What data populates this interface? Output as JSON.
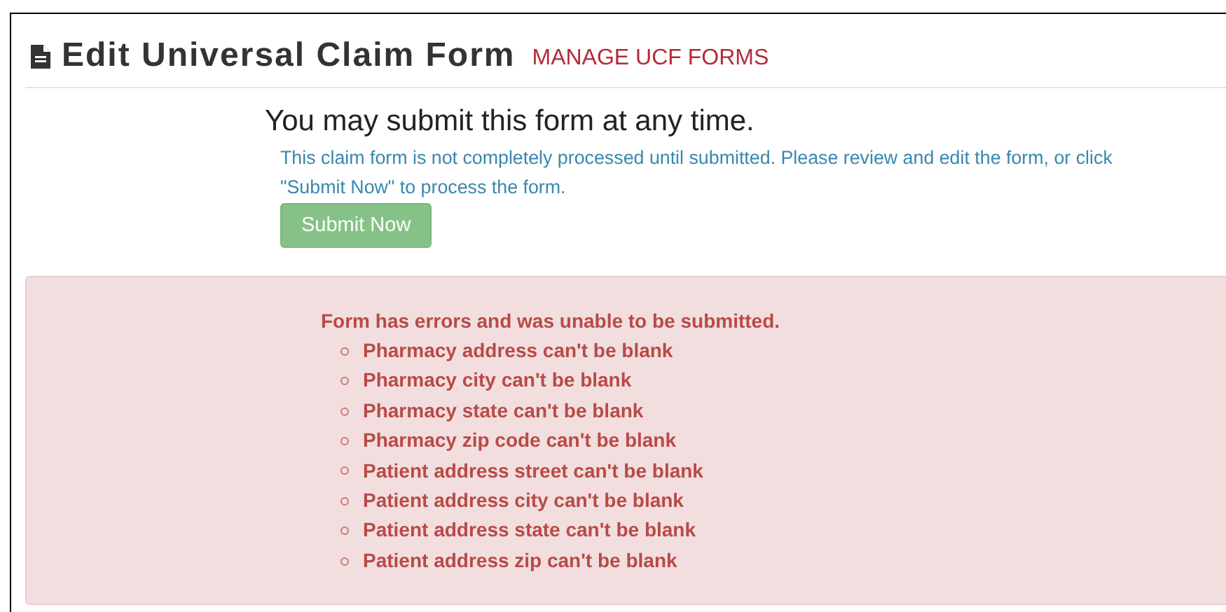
{
  "header": {
    "title": "Edit Universal Claim Form",
    "link": "MANAGE UCF FORMS"
  },
  "notice": {
    "heading": "You may submit this form at any time.",
    "text": "This claim form is not completely processed until submitted. Please review and edit the form, or click \"Submit Now\" to process the form.",
    "button": "Submit Now"
  },
  "errors": {
    "heading": "Form has errors and was unable to be submitted.",
    "items": [
      "Pharmacy address can't be blank",
      "Pharmacy city can't be blank",
      "Pharmacy state can't be blank",
      "Pharmacy zip code can't be blank",
      "Patient address street can't be blank",
      "Patient address city can't be blank",
      "Patient address state can't be blank",
      "Patient address zip can't be blank"
    ]
  }
}
